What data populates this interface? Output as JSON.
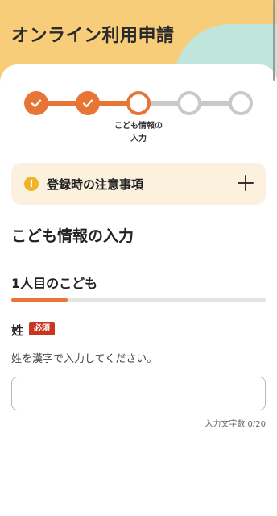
{
  "header": {
    "title": "オンライン利用申請"
  },
  "stepper": {
    "steps": [
      {
        "state": "done"
      },
      {
        "state": "done"
      },
      {
        "state": "current"
      },
      {
        "state": "todo"
      },
      {
        "state": "todo"
      }
    ],
    "current_label": "こども情報の\n入力"
  },
  "notice": {
    "icon": "warning-icon",
    "label": "登録時の注意事項",
    "toggle_icon": "plus-icon"
  },
  "section": {
    "title": "こども情報の入力"
  },
  "child_tab": {
    "label": "1人目のこども"
  },
  "field": {
    "label": "姓",
    "required_badge": "必須",
    "hint": "姓を漢字で入力してください。",
    "value": "",
    "placeholder": "",
    "counter": "入力文字数 0/20"
  },
  "colors": {
    "accent": "#e67536",
    "header_bg": "#f8cd7a",
    "header_blob": "#bfe5dc",
    "notice_bg": "#fbf1de",
    "required": "#c8361f"
  }
}
